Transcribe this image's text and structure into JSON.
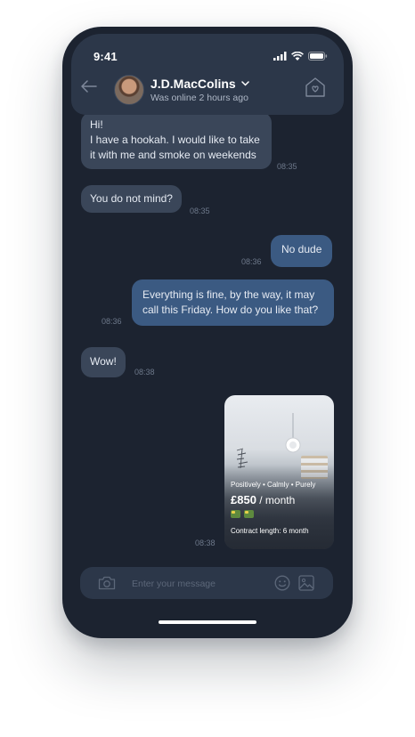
{
  "status_bar": {
    "time": "9:41"
  },
  "header": {
    "contact_name": "J.D.MacColins",
    "contact_status": "Was online 2 hours ago"
  },
  "messages": [
    {
      "direction": "in",
      "text_lines": [
        "Hi!",
        "I have a hookah. I would like to take",
        "it with me and smoke on weekends"
      ],
      "time": "08:35"
    },
    {
      "direction": "in",
      "text": "You do not mind?",
      "time": "08:35"
    },
    {
      "direction": "out",
      "text": "No dude",
      "time": "08:36"
    },
    {
      "direction": "out",
      "text_lines": [
        "Everything is fine, by the way, it may",
        "call this Friday. How do you like that?"
      ],
      "time": "08:36"
    },
    {
      "direction": "in",
      "text": "Wow!",
      "time": "08:38"
    }
  ],
  "listing_card": {
    "tags": "Positively • Calmly • Purely",
    "price": "£850",
    "price_period": " / month",
    "beds": 2,
    "contract": "Contract length: 6 month",
    "time": "08:38"
  },
  "composer": {
    "placeholder": "Enter your message"
  },
  "colors": {
    "background": "#1c2330",
    "header": "#2c3749",
    "incoming_bubble": "#3a4659",
    "outgoing_bubble": "#3b5a82"
  },
  "icons": [
    "signal-icon",
    "wifi-icon",
    "battery-icon",
    "back-arrow-icon",
    "chevron-down-icon",
    "home-heart-icon",
    "camera-icon",
    "emoji-icon",
    "image-icon"
  ]
}
